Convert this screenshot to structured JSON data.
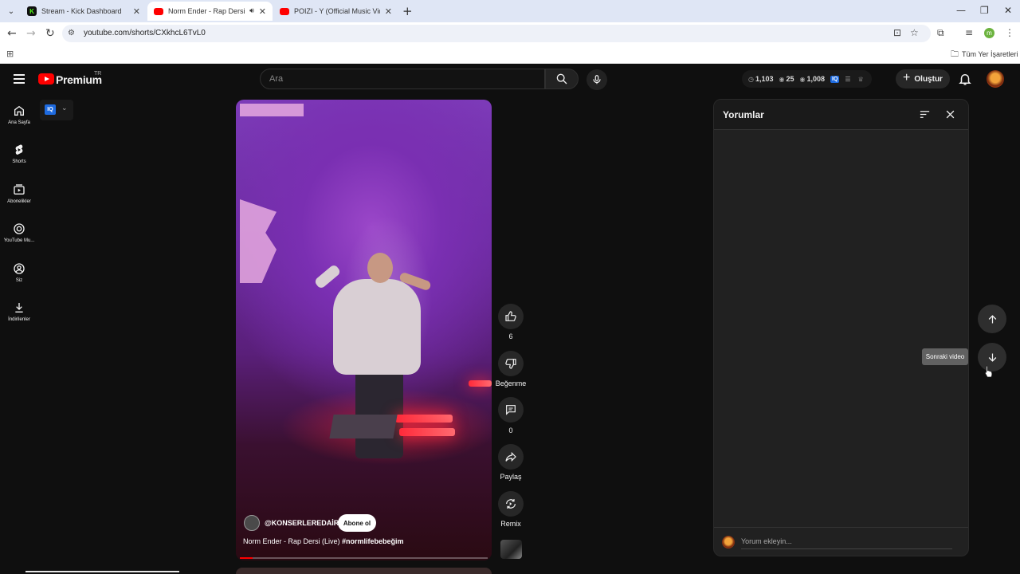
{
  "browser": {
    "tabs": [
      {
        "title": "Stream - Kick Dashboard",
        "active": false
      },
      {
        "title": "Norm Ender - Rap Dersi (Li",
        "active": true
      },
      {
        "title": "POIZI - Y (Official Music Video)",
        "active": false
      }
    ],
    "url": "youtube.com/shorts/CXkhcL6TvL0",
    "profile_initial": "m",
    "bookmarks_label": "Tüm Yer İşaretleri"
  },
  "header": {
    "brand": "Premium",
    "region": "TR",
    "search_placeholder": "Ara",
    "stats": {
      "clock": "1,103",
      "views": "25",
      "eye": "1,008",
      "iq": "IQ"
    },
    "create_label": "Oluştur"
  },
  "sidebar": {
    "items": [
      {
        "label": "Ana Sayfa",
        "icon": "home-icon"
      },
      {
        "label": "Shorts",
        "icon": "shorts-icon"
      },
      {
        "label": "Abonelikler",
        "icon": "subscriptions-icon"
      },
      {
        "label": "YouTube Mu...",
        "icon": "youtube-music-icon"
      },
      {
        "label": "Siz",
        "icon": "you-icon"
      },
      {
        "label": "İndirilenler",
        "icon": "downloads-icon"
      }
    ]
  },
  "extension": {
    "label": "IQ"
  },
  "video": {
    "channel": "@KONSERLEREDAİR",
    "subscribe_label": "Abone ol",
    "title": "Norm Ender - Rap Dersi (Live)",
    "hashtag": "#normlifebebeğim",
    "progress": 0.05
  },
  "actions": {
    "like_count": "6",
    "dislike_label": "Beğenme",
    "comment_count": "0",
    "share_label": "Paylaş",
    "remix_label": "Remix"
  },
  "comments": {
    "title": "Yorumlar",
    "placeholder": "Yorum ekleyin..."
  },
  "navigation": {
    "tooltip": "Sonraki video"
  }
}
